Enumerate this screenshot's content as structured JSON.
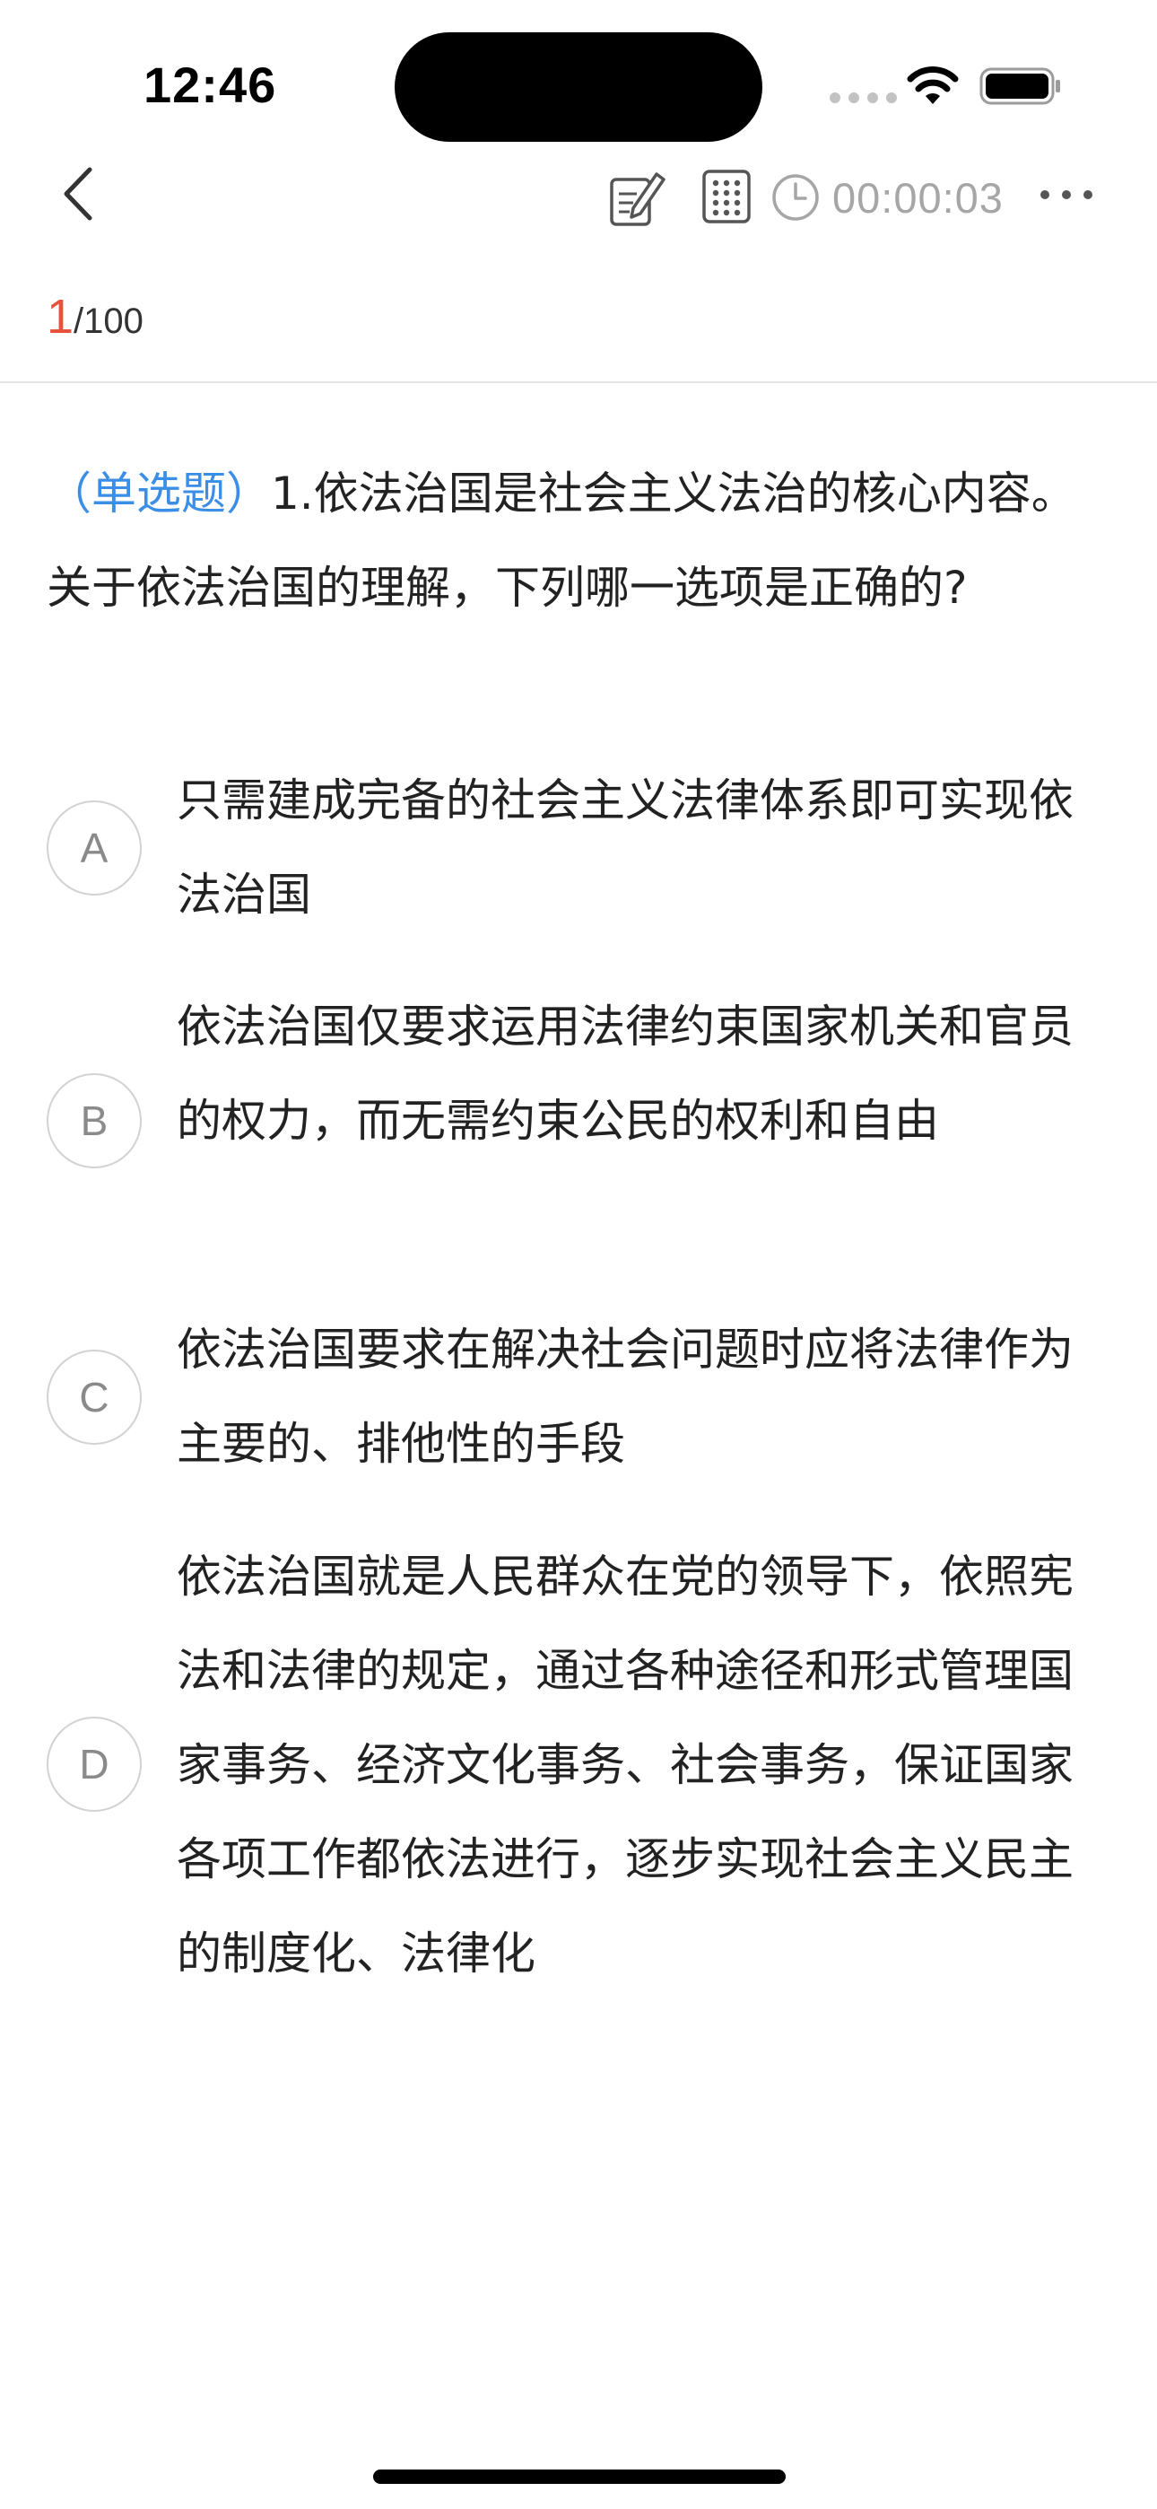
{
  "status_bar": {
    "time": "12:46"
  },
  "nav": {
    "timer": "00:00:03",
    "icons": [
      "back-chevron-icon",
      "note-edit-icon",
      "answer-sheet-grid-icon",
      "clock-icon",
      "more-dots-icon"
    ]
  },
  "progress": {
    "current": "1",
    "total": "/100"
  },
  "question": {
    "type_label": "（单选题）",
    "text": "1.依法治国是社会主义法治的核心内容。关于依法治国的理解，下列哪一选项是正确的?"
  },
  "options": [
    {
      "letter": "A",
      "text": "只需建成完备的社会主义法律体系即可实现依法治国"
    },
    {
      "letter": "B",
      "text": "依法治国仅要求运用法律约束国家机关和官员的权力，而无需约束公民的权利和自由"
    },
    {
      "letter": "C",
      "text": "依法治国要求在解决社会问题时应将法律作为主要的、排他性的手段"
    },
    {
      "letter": "D",
      "text": "依法治国就是人民群众在党的领导下，依照宪法和法律的规定，通过各种途径和形式管理国家事务、经济文化事务、社会事务，保证国家各项工作都依法进行，逐步实现社会主义民主的制度化、法律化"
    }
  ],
  "colors": {
    "accent_blue": "#3a8ee6",
    "progress_red": "#e5533d",
    "muted_gray": "#a6a6a6"
  }
}
